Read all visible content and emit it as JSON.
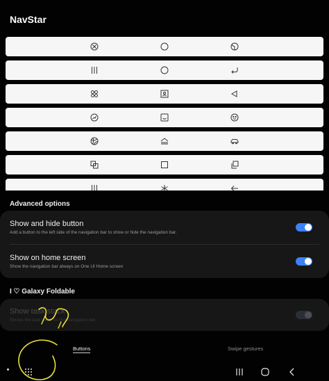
{
  "app": {
    "title": "NavStar"
  },
  "button_styles": [
    {
      "left": "circle-x-icon",
      "center": "circle-icon",
      "right": "circle-slice-icon"
    },
    {
      "left": "recents-lines-icon",
      "center": "circle-icon",
      "right": "return-arrow-icon"
    },
    {
      "left": "four-dots-icon",
      "center": "portrait-frame-icon",
      "right": "triangle-back-icon"
    },
    {
      "left": "circle-chart-icon",
      "center": "smile-square-icon",
      "right": "smiley-face-icon"
    },
    {
      "left": "dribbble-ball-icon",
      "center": "home-stack-icon",
      "right": "car-icon"
    },
    {
      "left": "overlap-squares-icon",
      "center": "square-icon",
      "right": "copy-squares-icon"
    },
    {
      "left": "recents-lines-icon",
      "center": "asterisk-icon",
      "right": "left-arrow-icon"
    }
  ],
  "advanced": {
    "title": "Advanced options",
    "options": [
      {
        "title": "Show and hide button",
        "subtitle": "Add a button to the left side of the navigation bar to show or hide the navigation bar.",
        "on": true
      },
      {
        "title": "Show on home screen",
        "subtitle": "Show the navigation bar always on One UI Home screen",
        "on": true
      }
    ]
  },
  "foldable": {
    "title": "I ♡ Galaxy Foldable",
    "option": {
      "title": "Show task stack",
      "subtitle": "Shows the task stack on the navigation bar.",
      "on": false
    }
  },
  "tabs": [
    "Buttons",
    "Swipe gestures"
  ],
  "colors": {
    "accent": "#3b82f6",
    "background": "#020202",
    "card": "#171717",
    "style_row": "#f6f6f6"
  }
}
